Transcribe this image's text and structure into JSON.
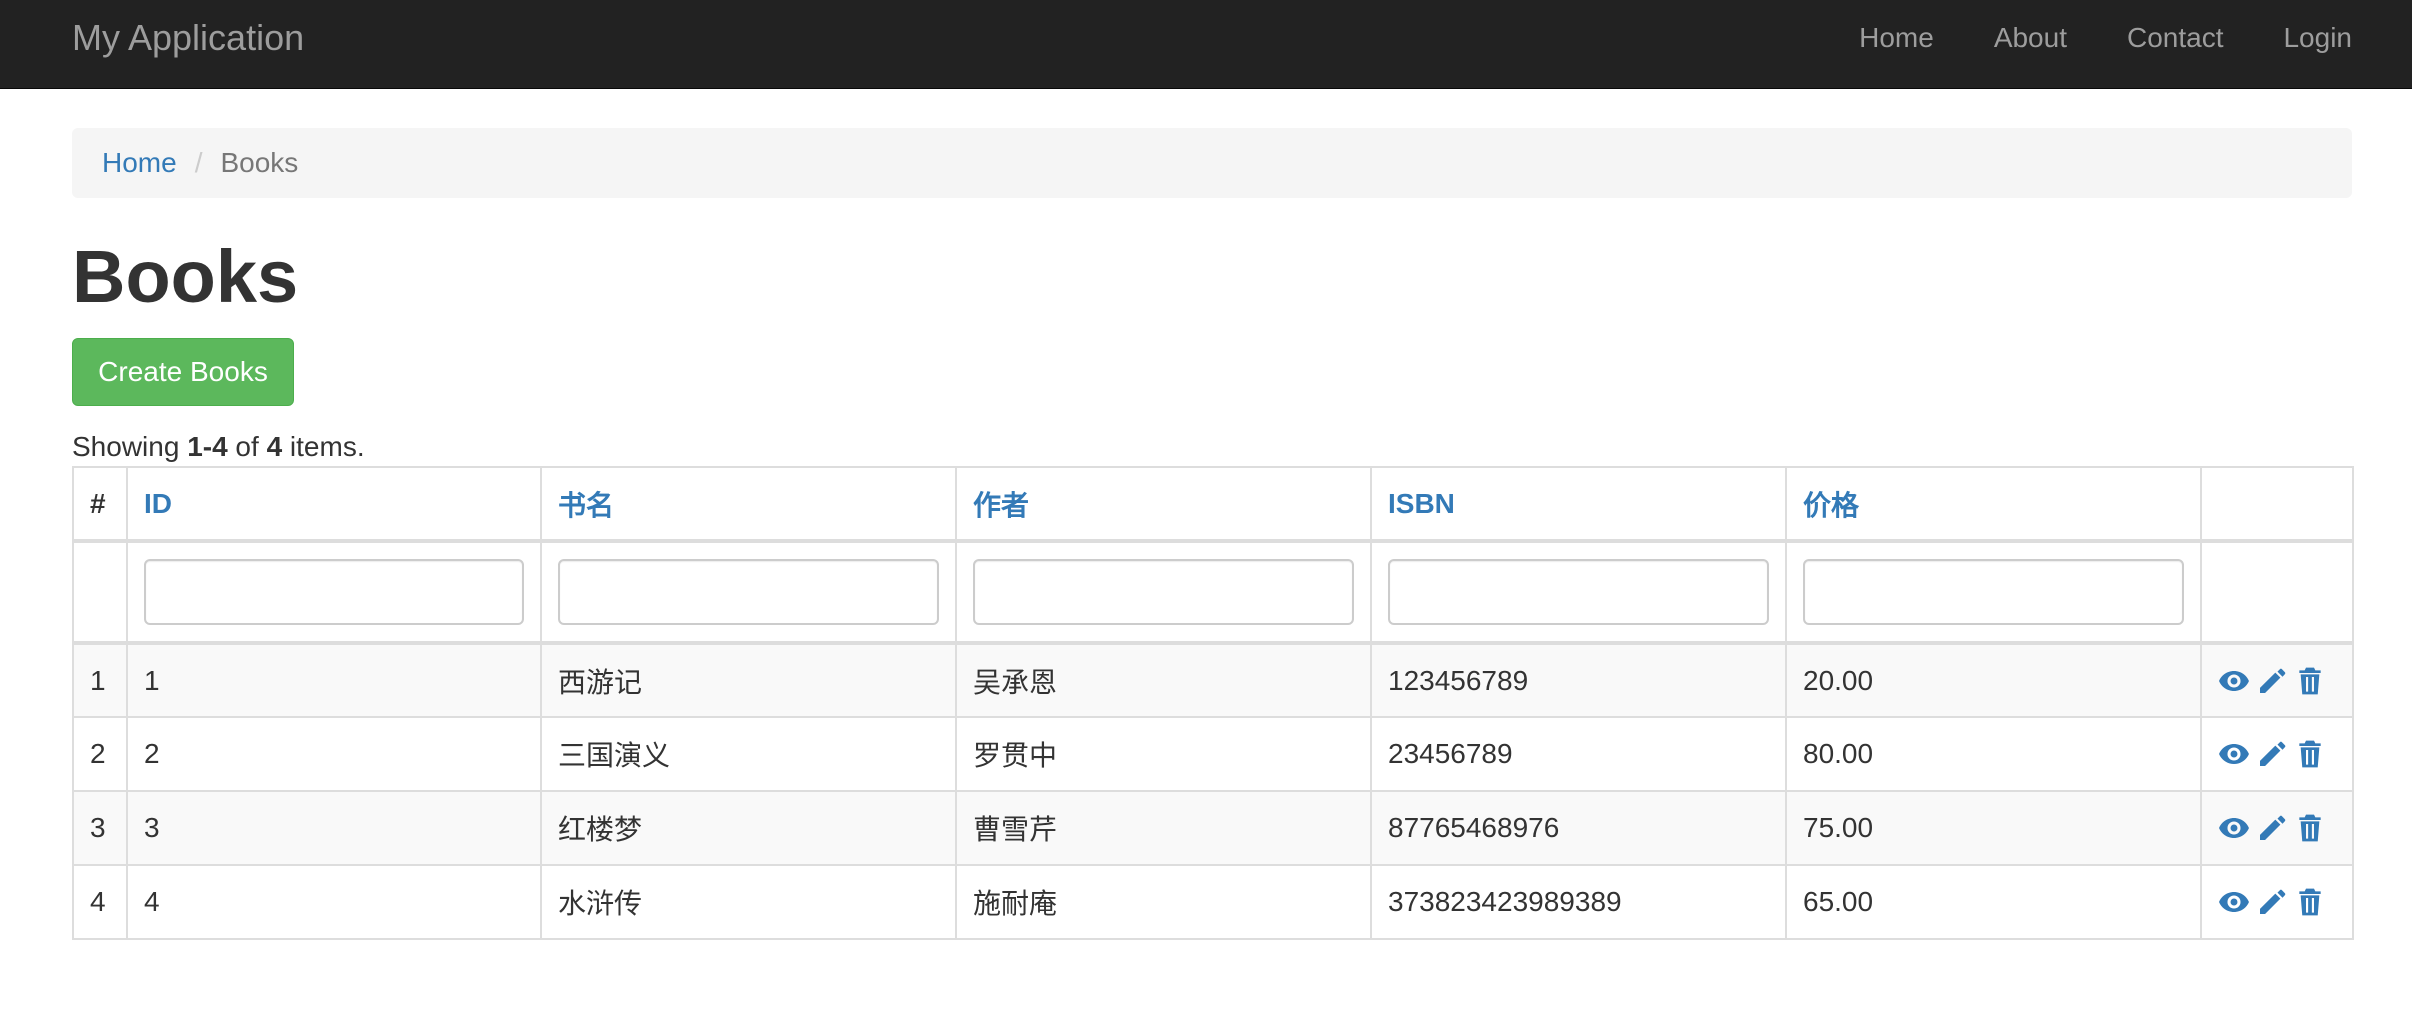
{
  "navbar": {
    "brand": "My Application",
    "links": [
      "Home",
      "About",
      "Contact",
      "Login"
    ]
  },
  "breadcrumb": {
    "home": "Home",
    "separator": "/",
    "active": "Books"
  },
  "page": {
    "title": "Books",
    "create_button": "Create Books",
    "summary": {
      "prefix": "Showing ",
      "range": "1-4",
      "of": " of ",
      "total": "4",
      "suffix": " items."
    }
  },
  "table": {
    "columns": [
      "#",
      "ID",
      "书名",
      "作者",
      "ISBN",
      "价格",
      ""
    ],
    "filters": {
      "id": "",
      "name": "",
      "author": "",
      "isbn": "",
      "price": ""
    },
    "rows": [
      {
        "serial": "1",
        "id": "1",
        "name": "西游记",
        "author": "吴承恩",
        "isbn": "123456789",
        "price": "20.00"
      },
      {
        "serial": "2",
        "id": "2",
        "name": "三国演义",
        "author": "罗贯中",
        "isbn": "23456789",
        "price": "80.00"
      },
      {
        "serial": "3",
        "id": "3",
        "name": "红楼梦",
        "author": "曹雪芹",
        "isbn": "87765468976",
        "price": "75.00"
      },
      {
        "serial": "4",
        "id": "4",
        "name": "水浒传",
        "author": "施耐庵",
        "isbn": "373823423989389",
        "price": "65.00"
      }
    ],
    "action_icons": [
      "eye-icon",
      "pencil-icon",
      "trash-icon"
    ]
  },
  "colors": {
    "navbar_bg": "#222222",
    "link": "#337ab7",
    "success": "#5cb85c",
    "stripe": "#f9f9f9",
    "border": "#dddddd"
  }
}
